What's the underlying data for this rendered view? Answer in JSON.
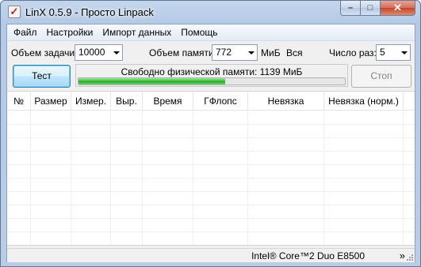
{
  "window": {
    "title": "LinX 0.5.9 - Просто Linpack",
    "minimize": "–",
    "maximize": "□",
    "close": "✕"
  },
  "menu": [
    "Файл",
    "Настройки",
    "Импорт данных",
    "Помощь"
  ],
  "task_size": {
    "label": "Объем задачи:",
    "value": "10000"
  },
  "memory": {
    "label": "Объем памяти:",
    "value": "772",
    "unit": "МиБ",
    "all_label": "Вся"
  },
  "runs": {
    "label": "Число раз:",
    "value": "5"
  },
  "buttons": {
    "test": "Тест",
    "stop": "Стоп"
  },
  "free_memory": {
    "text": "Свободно физической памяти: 1139 МиБ",
    "fill_fraction": 0.55
  },
  "table": {
    "columns": [
      "№",
      "Размер",
      "Измер.",
      "Выр.",
      "Время",
      "ГФлопс",
      "Невязка",
      "Невязка (норм.)"
    ],
    "rows": []
  },
  "status": {
    "cpu": "Intel® Core™2 Duo E8500",
    "more": "»"
  }
}
